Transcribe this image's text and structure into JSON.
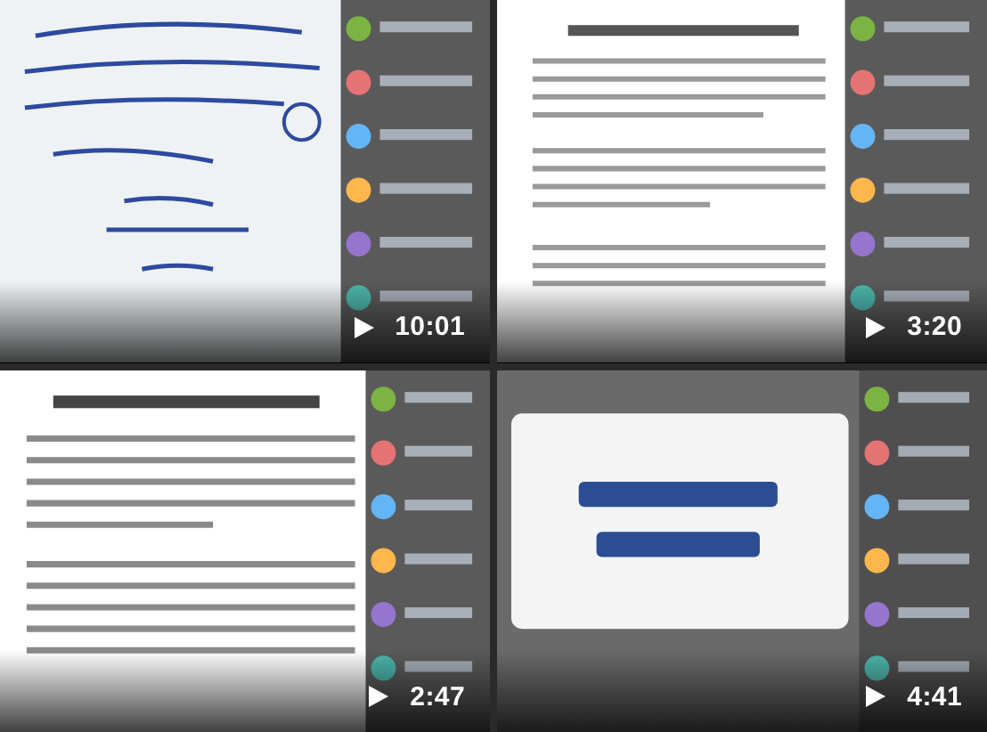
{
  "videos": [
    {
      "kind": "picture",
      "duration": "10:01"
    },
    {
      "kind": "picture",
      "duration": "3:20"
    },
    {
      "kind": "picture",
      "duration": "2:47"
    },
    {
      "kind": "picture",
      "duration": "4:41"
    }
  ]
}
